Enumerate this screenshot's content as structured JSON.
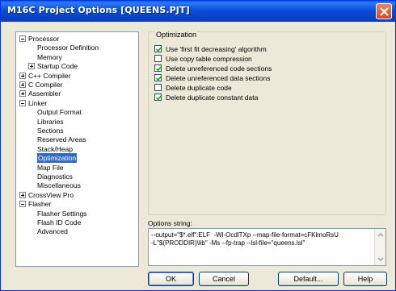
{
  "window": {
    "title": "M16C Project Options [QUEENS.PJT]"
  },
  "tree": {
    "items": [
      {
        "label": "Processor",
        "toggle": "minus",
        "level": 0
      },
      {
        "label": "Processor Definition",
        "level": 1
      },
      {
        "label": "Memory",
        "level": 1
      },
      {
        "label": "Startup Code",
        "toggle": "plus",
        "level": 1
      },
      {
        "label": "C++ Compiler",
        "toggle": "plus",
        "level": 0
      },
      {
        "label": "C Compiler",
        "toggle": "plus",
        "level": 0
      },
      {
        "label": "Assembler",
        "toggle": "plus",
        "level": 0
      },
      {
        "label": "Linker",
        "toggle": "minus",
        "level": 0
      },
      {
        "label": "Output Format",
        "level": 1
      },
      {
        "label": "Libraries",
        "level": 1
      },
      {
        "label": "Sections",
        "level": 1
      },
      {
        "label": "Reserved Areas",
        "level": 1
      },
      {
        "label": "Stack/Heap",
        "level": 1
      },
      {
        "label": "Optimization",
        "level": 1,
        "selected": true
      },
      {
        "label": "Map File",
        "level": 1
      },
      {
        "label": "Diagnostics",
        "level": 1
      },
      {
        "label": "Miscellaneous",
        "level": 1
      },
      {
        "label": "CrossView Pro",
        "toggle": "plus",
        "level": 0
      },
      {
        "label": "Flasher",
        "toggle": "minus",
        "level": 0
      },
      {
        "label": "Flasher Settings",
        "level": 1
      },
      {
        "label": "Flash ID Code",
        "level": 1
      },
      {
        "label": "Advanced",
        "level": 1
      }
    ]
  },
  "optimization": {
    "group_title": "Optimization",
    "options": [
      {
        "label": "Use 'first fit decreasing' algorithm",
        "checked": true
      },
      {
        "label": "Use copy table compression",
        "checked": false
      },
      {
        "label": "Delete unreferenced code sections",
        "checked": true
      },
      {
        "label": "Delete unreferenced data sections",
        "checked": true
      },
      {
        "label": "Delete duplicate code",
        "checked": false
      },
      {
        "label": "Delete duplicate constant data",
        "checked": true
      }
    ]
  },
  "options_string": {
    "label": "Options string:",
    "value": "--output=\"$*.elf\":ELF  -Wl-OcdlTXp --map-file-format=cFKlmoRsU\n-L\"$(PRODDIR)\\lib\" -Ms --fp-trap --lsl-file=\"queens.lsl\""
  },
  "buttons": {
    "ok": "OK",
    "cancel": "Cancel",
    "default": "Default...",
    "help": "Help"
  }
}
